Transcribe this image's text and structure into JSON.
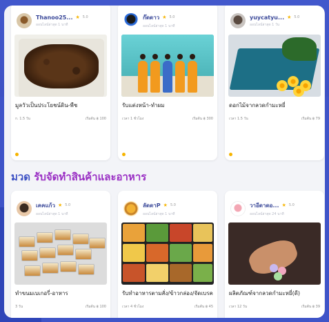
{
  "section": {
    "prefix": "มวด",
    "title": "รับจัดทำสินค้าและอาหาร"
  },
  "colors": {
    "background": "#3f54c8",
    "accent_blue": "#3e52c4",
    "accent_purple": "#9a2fc4",
    "star": "#f6b400"
  },
  "top_cards": [
    {
      "seller": "Thanoo25...",
      "rating": "5.0",
      "status": "ออนไลน์ล่าสุด 1 นาที",
      "title": "มูลวัวเป็นประโยชน์ดิน-พืช",
      "time": "ก. 1.5 วัน",
      "price": "เริ่มต้น ฿ 100",
      "photo_icon": "soil-sack-photo"
    },
    {
      "seller": "ก๊ดดาว",
      "rating": "5.0",
      "status": "ออนไลน์ล่าสุด 1 นาที",
      "title": "รับแต่งหน้า-ทำผม",
      "time": "เวลา 1 ชั่วโมง",
      "price": "เริ่มต้น ฿ 300",
      "photo_icon": "dancers-photo"
    },
    {
      "seller": "yuycatyu...",
      "rating": "5.0",
      "status": "ออนไลน์ล่าสุด 1 วัน",
      "title": "ดอกไม้จากลวดกำมะหยี่",
      "time": "เวลา 1.5 วัน",
      "price": "เริ่มต้น ฿ 79",
      "photo_icon": "flowers-tray-photo"
    }
  ],
  "bottom_cards": [
    {
      "seller": "เคคแก้ว",
      "rating": "5.0",
      "status": "ออนไลน์ล่าสุด 1 นาที",
      "title": "ทำขนมเบเกอรี่-อาหาร",
      "time": "3 วัน",
      "price": "เริ่มต้น ฿ 100",
      "photo_icon": "bakery-packs-photo"
    },
    {
      "seller": "ลัดดาP",
      "rating": "5.0",
      "status": "ออนไลน์ล่าสุด 1 นาที",
      "title": "รับทำอาหารตามสั่ง/ข้าวกล่อง/จัดเบรค",
      "time": "เวลา 4 ชั่วโมง",
      "price": "เริ่มต้น ฿ 45",
      "photo_icon": "meal-boxes-photo"
    },
    {
      "seller": "วาอีดาดอ...",
      "rating": "5.0",
      "status": "ออนไลน์ล่าสุด 24 นาที",
      "title": "ผลิตภัณฑ์จากลวดกำมะหยี่(ดี)",
      "time": "เวลา 12 วัน",
      "price": "เริ่มต้น ฿ 39",
      "photo_icon": "craft-hand-photo"
    }
  ]
}
